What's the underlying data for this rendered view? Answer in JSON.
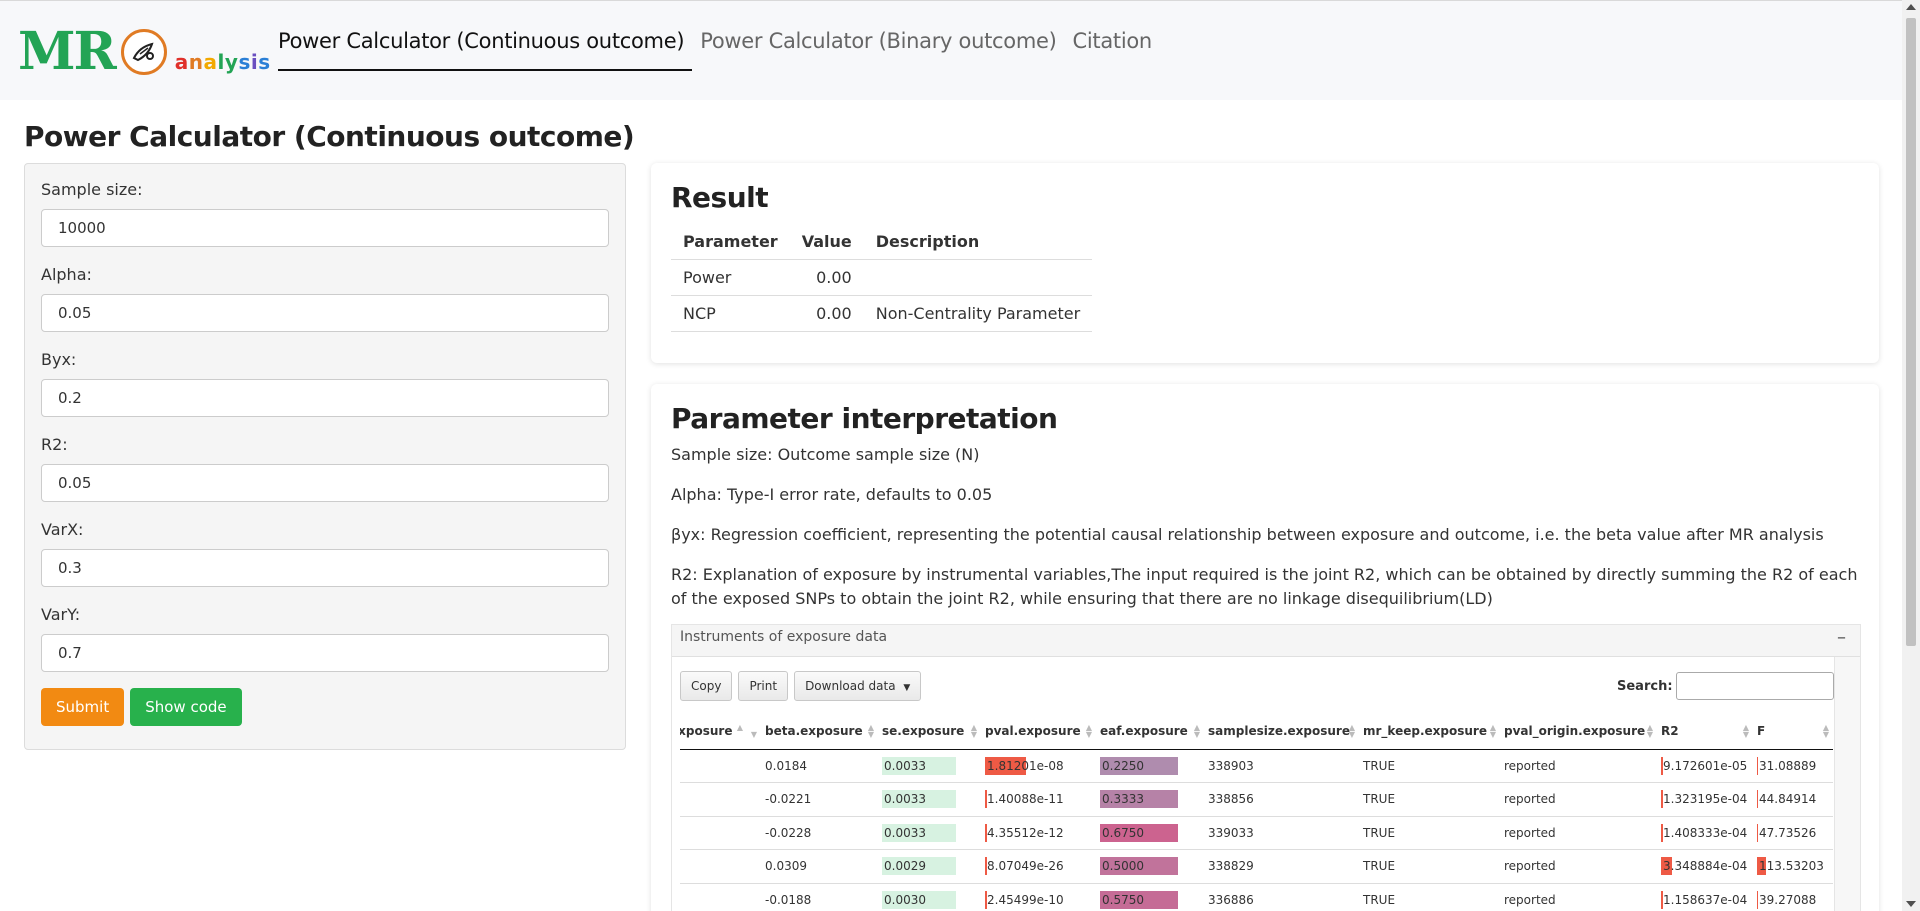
{
  "brand": {
    "mr": "MR",
    "analysis": "analysis",
    "accent_green": "#23a455",
    "accent_orange": "#e07b24"
  },
  "nav": [
    {
      "label": "Power Calculator (Continuous outcome)",
      "active": true
    },
    {
      "label": "Power Calculator (Binary outcome)",
      "active": false
    },
    {
      "label": "Citation",
      "active": false
    }
  ],
  "page_title": "Power Calculator (Continuous outcome)",
  "form": {
    "fields": [
      {
        "label": "Sample size:",
        "value": "10000"
      },
      {
        "label": "Alpha:",
        "value": "0.05"
      },
      {
        "label": "Byx:",
        "value": "0.2"
      },
      {
        "label": "R2:",
        "value": "0.05"
      },
      {
        "label": "VarX:",
        "value": "0.3"
      },
      {
        "label": "VarY:",
        "value": "0.7"
      }
    ],
    "submit_label": "Submit",
    "show_code_label": "Show code",
    "submit_color": "#f28a12",
    "show_code_color": "#28b14c"
  },
  "result": {
    "title": "Result",
    "headers": [
      "Parameter",
      "Value",
      "Description"
    ],
    "rows": [
      [
        "Power",
        "0.00",
        ""
      ],
      [
        "NCP",
        "0.00",
        "Non-Centrality Parameter"
      ]
    ]
  },
  "interpretation": {
    "title": "Parameter interpretation",
    "paragraphs": [
      "Sample size: Outcome sample size (N)",
      "Alpha: Type-I error rate, defaults to 0.05",
      "βyx: Regression coefficient, representing the potential causal relationship between exposure and outcome, i.e. the beta value after MR analysis",
      "R2: Explanation of exposure by instrumental variables,The input required is the joint R2, which can be obtained by directly summing the R2 of each of the exposed SNPs to obtain the joint R2, while ensuring that there are no linkage disequilibrium(LD)"
    ]
  },
  "instruments": {
    "title": "Instruments of exposure data",
    "collapse_symbol": "–",
    "buttons": [
      "Copy",
      "Print",
      "Download data"
    ],
    "search_label": "Search:",
    "columns": [
      "exposure",
      "beta.exposure",
      "se.exposure",
      "pval.exposure",
      "eaf.exposure",
      "samplesize.exposure",
      "mr_keep.exposure",
      "pval_origin.exposure",
      "R2",
      "F"
    ],
    "rows": [
      {
        "exposure": "",
        "beta": "0.0184",
        "beta_sign": "pos",
        "se": "0.0033",
        "pval": "1.81201e-08",
        "pval_frac": 0.38,
        "eaf": "0.2250",
        "eaf_frac": 0.225,
        "samplesize": "338903",
        "mr_keep": "TRUE",
        "pval_origin": "reported",
        "r2": "9.172601e-05",
        "r2_frac": 0.02,
        "f": "31.08889",
        "f_frac": 0.02
      },
      {
        "exposure": "",
        "beta": "-0.0221",
        "beta_sign": "neg",
        "se": "0.0033",
        "pval": "1.40088e-11",
        "pval_frac": 0.02,
        "eaf": "0.3333",
        "eaf_frac": 0.333,
        "samplesize": "338856",
        "mr_keep": "TRUE",
        "pval_origin": "reported",
        "r2": "1.323195e-04",
        "r2_frac": 0.02,
        "f": "44.84914",
        "f_frac": 0.02
      },
      {
        "exposure": "",
        "beta": "-0.0228",
        "beta_sign": "neg",
        "se": "0.0033",
        "pval": "4.35512e-12",
        "pval_frac": 0.02,
        "eaf": "0.6750",
        "eaf_frac": 0.675,
        "samplesize": "339033",
        "mr_keep": "TRUE",
        "pval_origin": "reported",
        "r2": "1.408333e-04",
        "r2_frac": 0.02,
        "f": "47.73526",
        "f_frac": 0.02
      },
      {
        "exposure": "",
        "beta": "0.0309",
        "beta_sign": "pos",
        "se": "0.0029",
        "pval": "8.07049e-26",
        "pval_frac": 0.02,
        "eaf": "0.5000",
        "eaf_frac": 0.5,
        "samplesize": "338829",
        "mr_keep": "TRUE",
        "pval_origin": "reported",
        "r2": "3.348884e-04",
        "r2_frac": 0.12,
        "f": "113.53203",
        "f_frac": 0.12
      },
      {
        "exposure": "",
        "beta": "-0.0188",
        "beta_sign": "neg",
        "se": "0.0030",
        "pval": "2.45499e-10",
        "pval_frac": 0.02,
        "eaf": "0.5750",
        "eaf_frac": 0.575,
        "samplesize": "336886",
        "mr_keep": "TRUE",
        "pval_origin": "reported",
        "r2": "1.158637e-04",
        "r2_frac": 0.02,
        "f": "39.27088",
        "f_frac": 0.02
      }
    ]
  }
}
